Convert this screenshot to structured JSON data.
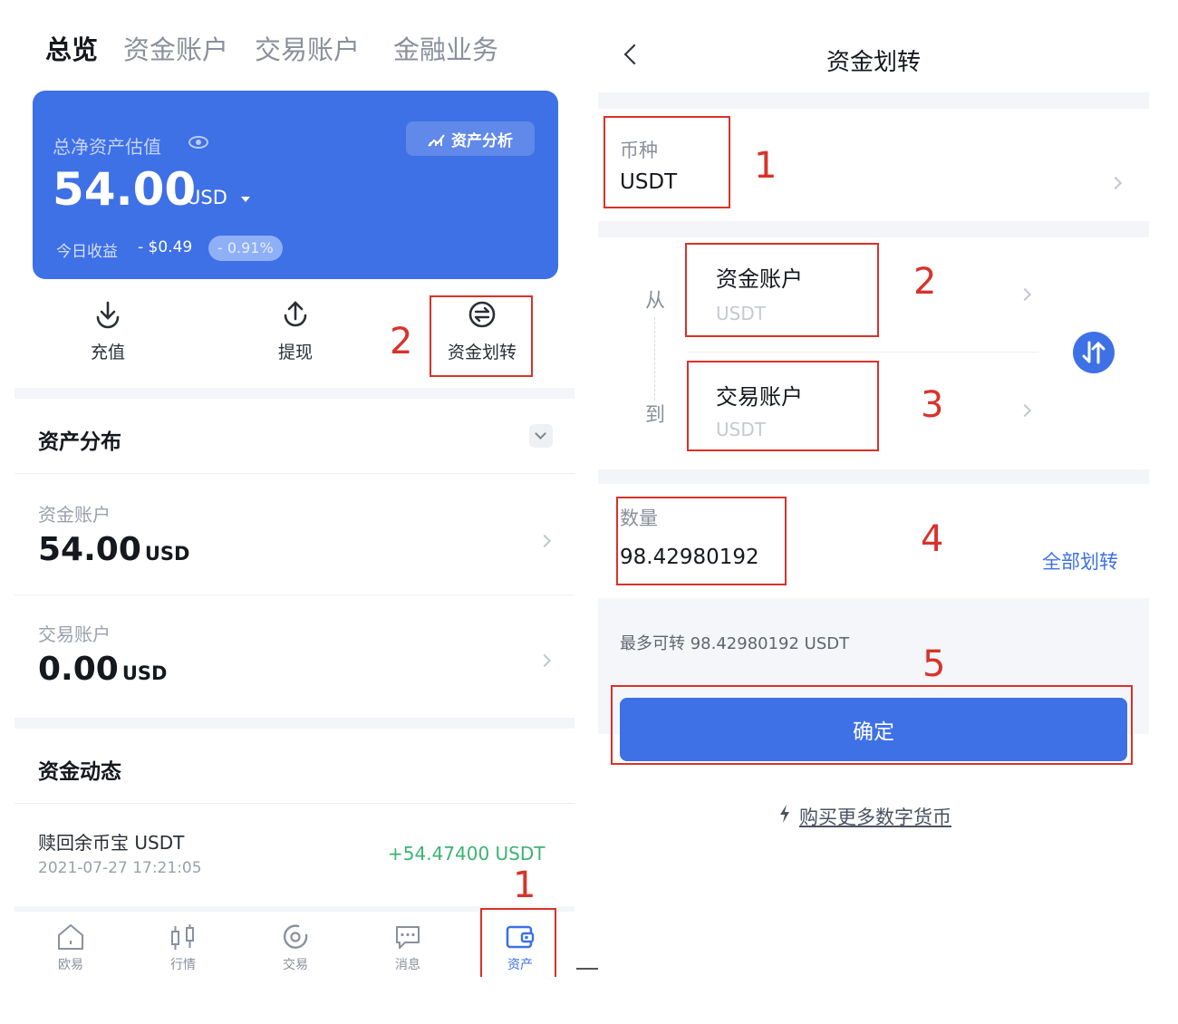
{
  "left": {
    "tabs": [
      "总览",
      "资金账户",
      "交易账户",
      "金融业务"
    ],
    "card": {
      "label": "总净资产估值",
      "analysis_btn": "资产分析",
      "amount": "54.00",
      "unit": "USD",
      "today_label": "今日收益",
      "today_value": "- $0.49",
      "today_pct": "- 0.91%"
    },
    "actions": [
      {
        "label": "充值",
        "icon": "deposit-icon"
      },
      {
        "label": "提现",
        "icon": "withdraw-icon"
      },
      {
        "label": "资金划转",
        "icon": "transfer-icon"
      }
    ],
    "distribution": {
      "title": "资产分布",
      "accounts": [
        {
          "name": "资金账户",
          "value": "54.00",
          "unit": "USD"
        },
        {
          "name": "交易账户",
          "value": "0.00",
          "unit": "USD"
        }
      ]
    },
    "activity": {
      "title": "资金动态",
      "item": {
        "title": "赎回余币宝 USDT",
        "date": "2021-07-27 17:21:05",
        "amount": "+54.47400 USDT"
      }
    },
    "nav": [
      "欧易",
      "行情",
      "交易",
      "消息",
      "资产"
    ],
    "markers": [
      "2",
      "1"
    ]
  },
  "right": {
    "title": "资金划转",
    "currency": {
      "label": "币种",
      "value": "USDT"
    },
    "from_label": "从",
    "to_label": "到",
    "from": {
      "name": "资金账户",
      "sub": "USDT"
    },
    "to": {
      "name": "交易账户",
      "sub": "USDT"
    },
    "quantity": {
      "label": "数量",
      "value": "98.42980192"
    },
    "all_transfer": "全部划转",
    "max_text": "最多可转  98.42980192 USDT",
    "confirm": "确定",
    "buy_link": "购买更多数字货币",
    "markers": [
      "1",
      "2",
      "3",
      "4",
      "5"
    ]
  },
  "colors": {
    "accent": "#3e70e6",
    "positive": "#3bb374",
    "annotation": "#d9322a"
  }
}
